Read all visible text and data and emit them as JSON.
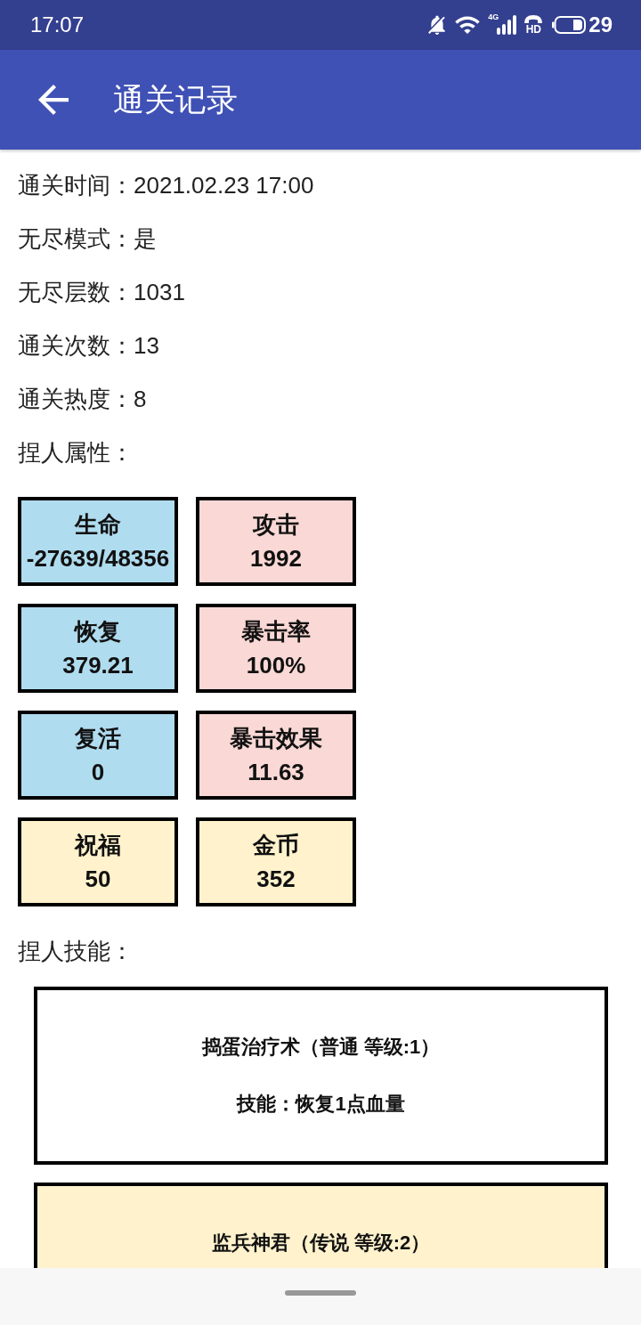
{
  "status_bar": {
    "time": "17:07",
    "network": "4G",
    "call": "HD",
    "battery": "29"
  },
  "app_bar": {
    "title": "通关记录"
  },
  "record": [
    {
      "label": "通关时间：",
      "value": "2021.02.23 17:00"
    },
    {
      "label": "无尽模式：",
      "value": "是"
    },
    {
      "label": "无尽层数：",
      "value": "1031"
    },
    {
      "label": "通关次数：",
      "value": "13"
    },
    {
      "label": "通关热度：",
      "value": "8"
    }
  ],
  "attributes": {
    "heading": "捏人属性：",
    "stats": [
      {
        "label": "生命",
        "value": "-27639/48356",
        "color": "#b0dcef"
      },
      {
        "label": "攻击",
        "value": "1992",
        "color": "#f9d8d5"
      },
      {
        "label": "恢复",
        "value": "379.21",
        "color": "#b0dcef"
      },
      {
        "label": "暴击率",
        "value": "100%",
        "color": "#f9d8d5"
      },
      {
        "label": "复活",
        "value": "0",
        "color": "#b0dcef"
      },
      {
        "label": "暴击效果",
        "value": "11.63",
        "color": "#f9d8d5"
      },
      {
        "label": "祝福",
        "value": "50",
        "color": "#fff2cc"
      },
      {
        "label": "金币",
        "value": "352",
        "color": "#fff2cc"
      }
    ]
  },
  "skills": {
    "heading": "捏人技能：",
    "cards": [
      {
        "name": "捣蛋治疗术（普通 等级:1）",
        "description": "技能：恢复1点血量",
        "color": "#ffffff"
      },
      {
        "name": "监兵神君（传说 等级:2）",
        "color": "#fff2cc"
      }
    ]
  }
}
